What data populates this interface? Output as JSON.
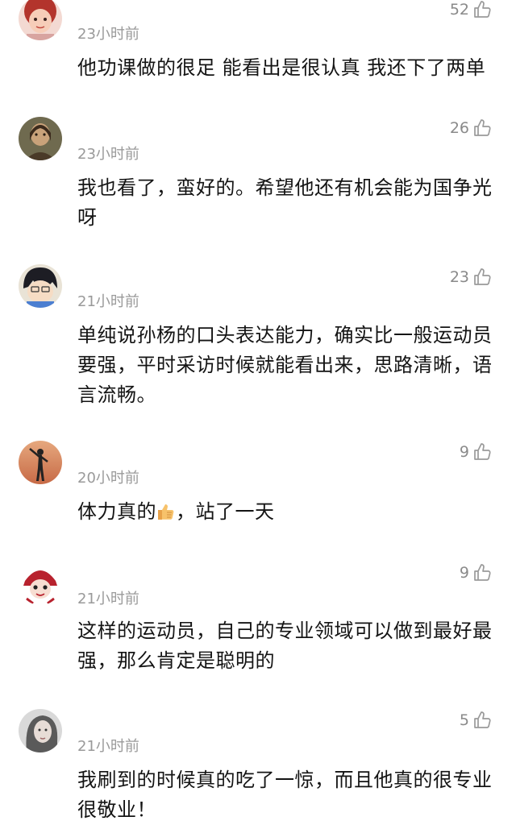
{
  "comments": [
    {
      "time": "23小时前",
      "likes": "52",
      "text": "他功课做的很足 能看出是很认真 我还下了两单",
      "avatar": "girl-red-hair-avatar"
    },
    {
      "time": "23小时前",
      "likes": "26",
      "text": "我也看了，蛮好的。希望他还有机会能为国争光呀",
      "avatar": "painting-portrait-avatar"
    },
    {
      "time": "21小时前",
      "likes": "23",
      "text": "单纯说孙杨的口头表达能力，确实比一般运动员要强，平时采访时候就能看出来，思路清晰，语言流畅。",
      "avatar": "cartoon-boy-avatar"
    },
    {
      "time": "20小时前",
      "likes": "9",
      "text_before": "体力真的",
      "text_after": "，站了一天",
      "avatar": "silhouette-sunset-avatar"
    },
    {
      "time": "21小时前",
      "likes": "9",
      "text": "这样的运动员，自己的专业领域可以做到最好最强，那么肯定是聪明的",
      "avatar": "cartoon-red-hat-avatar"
    },
    {
      "time": "21小时前",
      "likes": "5",
      "text": "我刷到的时候真的吃了一惊，而且他真的很专业很敬业！",
      "avatar": "grey-portrait-avatar"
    }
  ],
  "colors": {
    "text": "#141414",
    "meta": "#9a9a9a",
    "likes": "#8a8a8a"
  }
}
